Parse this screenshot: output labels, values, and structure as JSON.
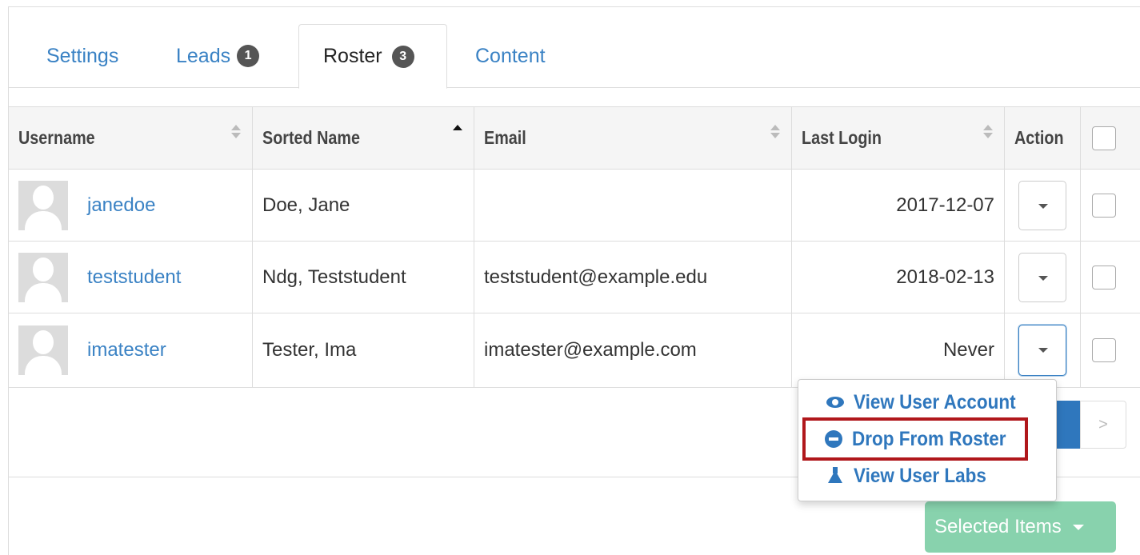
{
  "tabs": [
    {
      "label": "Settings",
      "badge": null
    },
    {
      "label": "Leads",
      "badge": "1"
    },
    {
      "label": "Roster",
      "badge": "3"
    },
    {
      "label": "Content",
      "badge": null
    }
  ],
  "active_tab": "Roster",
  "table": {
    "headers": {
      "username": "Username",
      "sorted_name": "Sorted Name",
      "email": "Email",
      "last_login": "Last Login",
      "action": "Action"
    },
    "sorted_by": "Sorted Name",
    "sort_direction": "ascending",
    "rows": [
      {
        "username": "janedoe",
        "sorted_name": "Doe, Jane",
        "email": "",
        "last_login": "2017-12-07"
      },
      {
        "username": "teststudent",
        "sorted_name": "Ndg, Teststudent",
        "email": "teststudent@example.edu",
        "last_login": "2018-02-13"
      },
      {
        "username": "imatester",
        "sorted_name": "Tester, Ima",
        "email": "imatester@example.com",
        "last_login": "Never"
      }
    ]
  },
  "action_menu": {
    "items": [
      {
        "label": "View User Account",
        "icon": "eye-icon"
      },
      {
        "label": "Drop From Roster",
        "icon": "minus-circle-icon"
      },
      {
        "label": "View User Labs",
        "icon": "flask-icon"
      }
    ],
    "highlighted": "Drop From Roster"
  },
  "pagination": {
    "next_label": ">"
  },
  "footer": {
    "selected_items_label": "Selected Items"
  },
  "colors": {
    "link": "#3a82c4",
    "primary": "#2f77bd",
    "success_button": "#88d2ad",
    "highlight_box": "#b0171b",
    "badge": "#555555"
  }
}
